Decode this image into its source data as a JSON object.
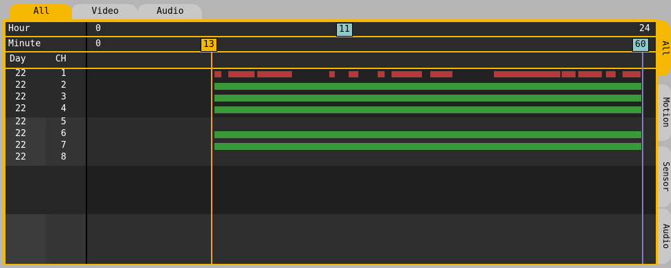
{
  "top_tabs": [
    {
      "label": "All",
      "active": true
    },
    {
      "label": "Video",
      "active": false
    },
    {
      "label": "Audio",
      "active": false
    }
  ],
  "side_tabs": [
    {
      "label": "All",
      "active": true
    },
    {
      "label": "Motion",
      "active": false
    },
    {
      "label": "Sensor",
      "active": false
    },
    {
      "label": "Audio",
      "active": false
    }
  ],
  "hour_row": {
    "label": "Hour",
    "start": "0",
    "end": "24",
    "marker": "11"
  },
  "minute_row": {
    "label": "Minute",
    "start": "0",
    "end": "60",
    "marker": "13"
  },
  "columns": {
    "day": "Day",
    "ch": "CH"
  },
  "channels": [
    {
      "day": "22",
      "ch": "1"
    },
    {
      "day": "22",
      "ch": "2"
    },
    {
      "day": "22",
      "ch": "3"
    },
    {
      "day": "22",
      "ch": "4"
    },
    {
      "day": "22",
      "ch": "5"
    },
    {
      "day": "22",
      "ch": "6"
    },
    {
      "day": "22",
      "ch": "7"
    },
    {
      "day": "22",
      "ch": "8"
    }
  ],
  "colors": {
    "accent": "#f5b700",
    "event_red": "#b23a3a",
    "record_green": "#3a9a3a",
    "hour_marker": "#8fc8c8",
    "minute_marker": "#f5b700",
    "cursor_line": "#f0a030",
    "end_line": "#8080c0"
  }
}
